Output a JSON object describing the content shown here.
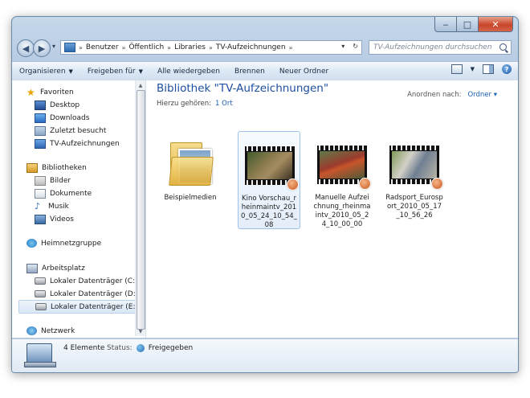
{
  "window": {
    "caption": {
      "minimize": "‒",
      "maximize": "□",
      "close": "✕"
    }
  },
  "address": {
    "breadcrumbs": [
      "Benutzer",
      "Öffentlich",
      "Libraries",
      "TV-Aufzeichnungen"
    ],
    "separator": "»",
    "search_placeholder": "TV-Aufzeichnungen durchsuchen"
  },
  "toolbar": {
    "organize": "Organisieren",
    "share": "Freigeben für",
    "play_all": "Alle wiedergeben",
    "burn": "Brennen",
    "new_folder": "Neuer Ordner"
  },
  "nav": {
    "favorites": "Favoriten",
    "favorites_items": [
      "Desktop",
      "Downloads",
      "Zuletzt besucht",
      "TV-Aufzeichnungen"
    ],
    "libraries": "Bibliotheken",
    "libraries_items": [
      "Bilder",
      "Dokumente",
      "Musik",
      "Videos"
    ],
    "homegroup": "Heimnetzgruppe",
    "computer": "Arbeitsplatz",
    "computer_items": [
      "Lokaler Datenträger (C:)",
      "Lokaler Datenträger (D:)",
      "Lokaler Datenträger (E:)"
    ],
    "network": "Netzwerk"
  },
  "content": {
    "title": "Bibliothek \"TV-Aufzeichnungen\"",
    "belongs_to": "Hierzu gehören:",
    "locations": "1 Ort",
    "arrange_by": "Anordnen nach:",
    "arrange_value": "Ordner",
    "items": [
      {
        "label": "Beispielmedien",
        "type": "folder"
      },
      {
        "label": "Kino Vorschau_rheinmaintv_2010_05_24_10_54_08",
        "type": "video"
      },
      {
        "label": "Manuelle Aufzeichnung_rheinmaintv_2010_05_24_10_00_00",
        "type": "video"
      },
      {
        "label": "Radsport_Eurosport_2010_05_17_10_56_26",
        "type": "video"
      }
    ]
  },
  "details": {
    "count": "4 Elemente",
    "status_label": "Status:",
    "status_value": "Freigegeben"
  },
  "colors": {
    "title_blue": "#1e4fa0",
    "link_blue": "#1a5fb4",
    "close_red": "#c8452a",
    "chrome": "#b7cbe2"
  }
}
